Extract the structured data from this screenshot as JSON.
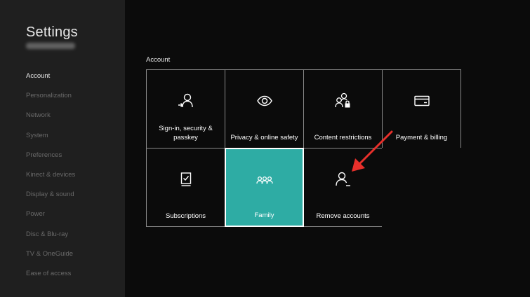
{
  "sidebar": {
    "title": "Settings",
    "items": [
      {
        "label": "Account"
      },
      {
        "label": "Personalization"
      },
      {
        "label": "Network"
      },
      {
        "label": "System"
      },
      {
        "label": "Preferences"
      },
      {
        "label": "Kinect & devices"
      },
      {
        "label": "Display & sound"
      },
      {
        "label": "Power"
      },
      {
        "label": "Disc & Blu-ray"
      },
      {
        "label": "TV & OneGuide"
      },
      {
        "label": "Ease of access"
      }
    ]
  },
  "main": {
    "section_label": "Account",
    "tiles": [
      {
        "label": "Sign-in, security & passkey",
        "icon": "user-arrow-icon"
      },
      {
        "label": "Privacy & online safety",
        "icon": "eye-icon"
      },
      {
        "label": "Content restrictions",
        "icon": "user-lock-icon"
      },
      {
        "label": "Payment & billing",
        "icon": "credit-card-icon"
      },
      {
        "label": "Subscriptions",
        "icon": "subscription-icon"
      },
      {
        "label": "Family",
        "icon": "family-icon"
      },
      {
        "label": "Remove accounts",
        "icon": "user-remove-icon"
      }
    ]
  },
  "colors": {
    "accent": "#2eaca4",
    "annotation_arrow": "#e8302b",
    "sidebar_bg": "#1f1f1f",
    "page_bg": "#0b0b0b"
  }
}
